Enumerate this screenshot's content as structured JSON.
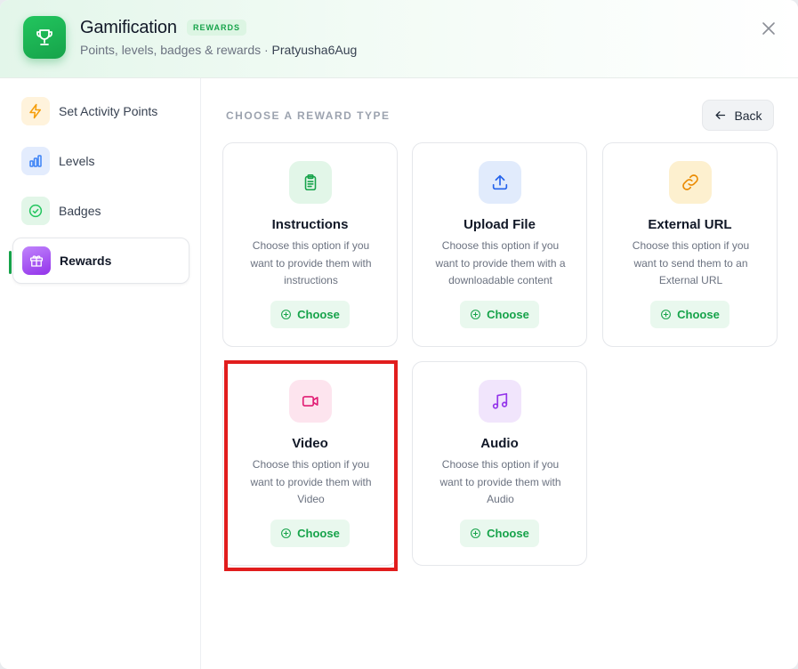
{
  "header": {
    "title": "Gamification",
    "badge": "REWARDS",
    "subtitle": "Points, levels, badges & rewards · ",
    "user": "Pratyusha6Aug"
  },
  "sidebar": {
    "items": [
      {
        "label": "Set Activity Points",
        "icon": "lightning-icon",
        "color": "#f59e0b",
        "bg": "#fff3dc"
      },
      {
        "label": "Levels",
        "icon": "bar-chart-icon",
        "color": "#3b82f6",
        "bg": "#e3ecfd"
      },
      {
        "label": "Badges",
        "icon": "check-circle-icon",
        "color": "#22c55e",
        "bg": "#e2f6e8"
      },
      {
        "label": "Rewards",
        "icon": "gift-icon",
        "color": "#ffffff",
        "bg": "#a855f7",
        "active": true
      }
    ]
  },
  "main": {
    "section_title": "CHOOSE A REWARD TYPE",
    "back_label": "Back",
    "choose_label": "Choose",
    "cards": [
      {
        "title": "Instructions",
        "desc": "Choose this option if you want to provide them with instructions",
        "icon": "clipboard-icon",
        "color": "#16a34a",
        "bg": "#e2f6e8"
      },
      {
        "title": "Upload File",
        "desc": "Choose this option if you want to provide them with a downloadable content",
        "icon": "upload-icon",
        "color": "#2563eb",
        "bg": "#e1ebfc"
      },
      {
        "title": "External URL",
        "desc": "Choose this option if you want to send them to an External URL",
        "icon": "link-icon",
        "color": "#ea8a00",
        "bg": "#fdf0cf"
      },
      {
        "title": "Video",
        "desc": "Choose this option if you want to provide them with Video",
        "icon": "video-icon",
        "color": "#e11d74",
        "bg": "#fde4ee"
      },
      {
        "title": "Audio",
        "desc": "Choose this option if you want to provide them with Audio",
        "icon": "music-icon",
        "color": "#9333ea",
        "bg": "#f1e5fc"
      }
    ]
  },
  "colors": {
    "accent": "#16a34a",
    "highlight": "#e11d1d"
  }
}
